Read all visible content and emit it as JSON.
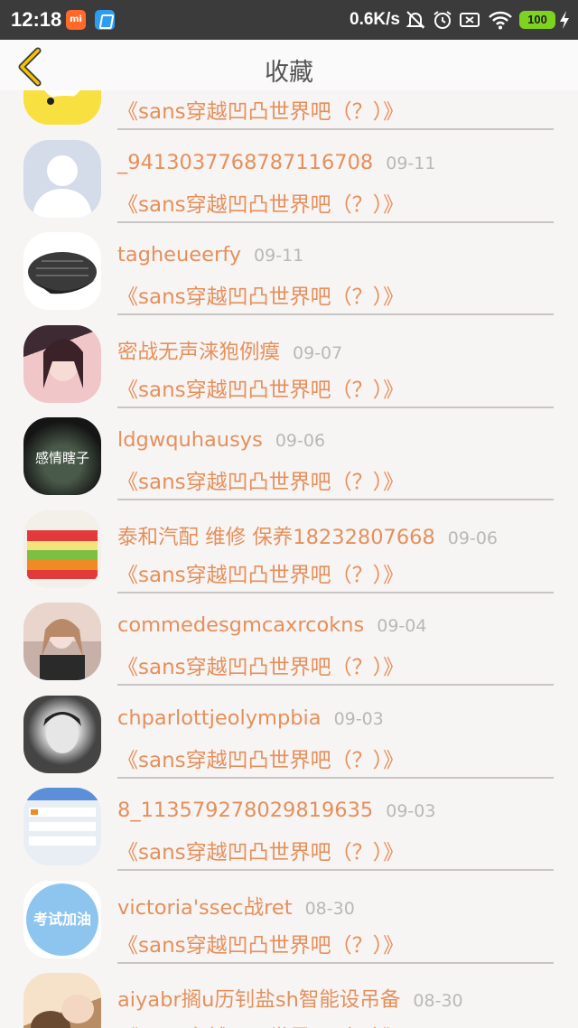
{
  "statusbar": {
    "time": "12:18",
    "mi_label": "mi",
    "network_speed": "0.6K/s",
    "battery": "100",
    "icons": [
      "mute-icon",
      "alarm-icon",
      "sim-x-icon",
      "wifi-icon",
      "charging-icon"
    ]
  },
  "header": {
    "title": "收藏",
    "back_icon": "chevron-left-icon"
  },
  "colors": {
    "accent": "#e5905b",
    "date": "#b8b8b8",
    "back": "#f5c400"
  },
  "favorites": [
    {
      "name": "",
      "date": "",
      "thread": "《sans穿越凹凸世界吧（？）》"
    },
    {
      "name": "_9413037768787116708",
      "date": "09-11",
      "thread": "《sans穿越凹凸世界吧（？）》"
    },
    {
      "name": "tagheueerfy",
      "date": "09-11",
      "thread": "《sans穿越凹凸世界吧（？）》"
    },
    {
      "name": "密战无声涞狍例瘼",
      "date": "09-07",
      "thread": "《sans穿越凹凸世界吧（？）》"
    },
    {
      "name": "ldgwquhausys",
      "date": "09-06",
      "thread": "《sans穿越凹凸世界吧（？）》",
      "avatar_text": "感情瞎子"
    },
    {
      "name": "泰和汽配 维修 保养18232807668",
      "date": "09-06",
      "thread": "《sans穿越凹凸世界吧（？）》"
    },
    {
      "name": "commedesgmcaxrcokns",
      "date": "09-04",
      "thread": "《sans穿越凹凸世界吧（？）》"
    },
    {
      "name": "chparlottjeolympbia",
      "date": "09-03",
      "thread": "《sans穿越凹凸世界吧（？）》"
    },
    {
      "name": "8_113579278029819635",
      "date": "09-03",
      "thread": "《sans穿越凹凸世界吧（？）》"
    },
    {
      "name": "victoria'ssec战ret",
      "date": "08-30",
      "thread": "《sans穿越凹凸世界吧（？）》",
      "avatar_text": "考试加油"
    },
    {
      "name": "aiyabr搁u历钊盐sh智能设吊备",
      "date": "08-30",
      "thread": "《sans穿越凹凸世界吧（？）》"
    }
  ]
}
